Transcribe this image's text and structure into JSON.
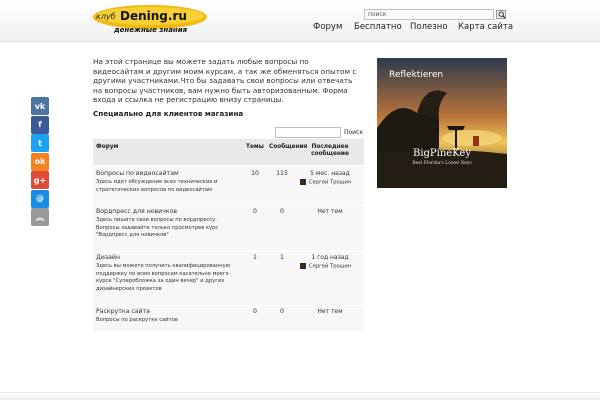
{
  "header": {
    "logo_top": "клуб",
    "logo_brand": "Dening.ru",
    "logo_tagline": "денежные знания",
    "search_placeholder": "поиск",
    "nav": [
      {
        "label": "Форум"
      },
      {
        "label": "Бесплатно"
      },
      {
        "label": "Полезно"
      },
      {
        "label": "Карта сайта"
      }
    ]
  },
  "share": [
    {
      "name": "vk",
      "glyph": "vk",
      "color": "#4c75a3"
    },
    {
      "name": "facebook",
      "glyph": "f",
      "color": "#3b5998"
    },
    {
      "name": "twitter",
      "glyph": "t",
      "color": "#1da1f2"
    },
    {
      "name": "odnoklassniki",
      "glyph": "ok",
      "color": "#f58220"
    },
    {
      "name": "google-plus",
      "glyph": "g+",
      "color": "#dd4b39"
    },
    {
      "name": "mail",
      "glyph": "@",
      "color": "#168de2"
    },
    {
      "name": "more",
      "glyph": "︽",
      "color": "#999999"
    }
  ],
  "intro": "На этой странице вы можете задать  любые вопросы по видеосайтам и другим моим курсам, а так же обменяться опытом с другими участниками.Что бы задавать свои вопросы или отвечать на вопросы участников, вам нужно быть авторизованным. Форма входа и ссылка не регистрацию внизу страницы.",
  "section_title": "Специально для клиентов магазина",
  "forum_search": {
    "button": "Поиск"
  },
  "table": {
    "headers": {
      "forum": "Форум",
      "topics": "Темы",
      "posts": "Сообщения",
      "last": "Последнее сообщение"
    },
    "rows": [
      {
        "name": "Вопросы по видеосайтам",
        "desc": "Здесь идет обсуждение всех технических и стратегических вопросов по видеосайтам",
        "topics": "10",
        "posts": "115",
        "last": "5 мес. назад",
        "user": "Сергей Трошин"
      },
      {
        "name": "Вордпресс для новичков",
        "desc": "Здесь пишите свои вопросы по вордпрессу. Вопросы задавайте только просмотрев курс \"Вордпресс для новичков\"",
        "topics": "0",
        "posts": "0",
        "last": "Нет тем",
        "user": ""
      },
      {
        "name": "Дизайн",
        "desc": "Здесь вы можете получить квалифицированную поддержку по всем вопросам касательно моего курса \"Суперобложка за один вечер\" и других  дизайнерских проектов",
        "topics": "1",
        "posts": "1",
        "last": "1 год назад",
        "user": "Сергей Трошин"
      },
      {
        "name": "Раскрутка сайта",
        "desc": "Вопросы по раскрутке сайтов",
        "topics": "0",
        "posts": "0",
        "last": "Нет тем",
        "user": ""
      }
    ]
  },
  "ad": {
    "title": "Reflektieren",
    "brand": "BigPineKey",
    "subtitle": "Best Florida's Lower Keys"
  }
}
